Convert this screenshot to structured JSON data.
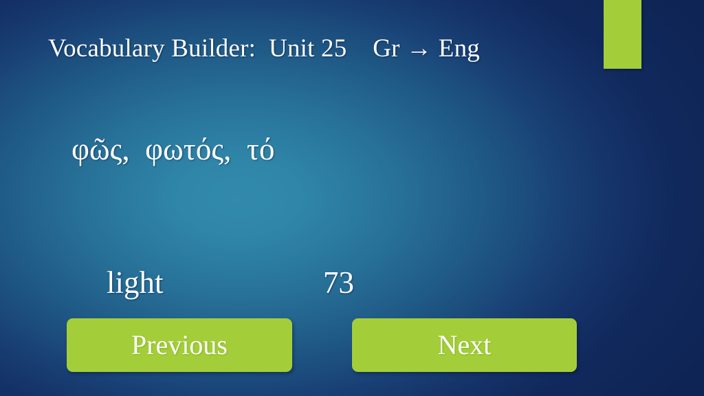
{
  "slide": {
    "title": "Vocabulary Builder:  Unit 25    Gr → Eng",
    "background_color_center": "#3189ab",
    "background_color_edge": "#122c62",
    "accent_color": "#a4ce39"
  },
  "vocab": {
    "term": "φῶς,  φωτός,  τό",
    "gloss": "light",
    "number": "73"
  },
  "nav": {
    "previous_label": "Previous",
    "next_label": "Next"
  }
}
